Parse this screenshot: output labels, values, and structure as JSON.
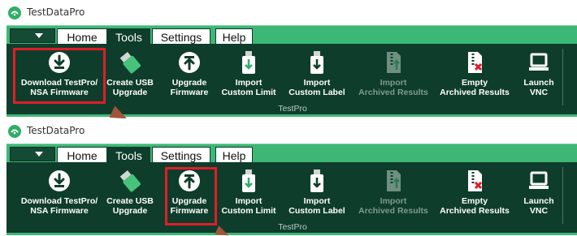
{
  "panels": [
    {
      "app": {
        "title": "TestDataPro",
        "logo": "testdatapro-logo-icon"
      },
      "tabs": [
        {
          "label": "Home",
          "active": false
        },
        {
          "label": "Tools",
          "active": true
        },
        {
          "label": "Settings",
          "active": false
        },
        {
          "label": "Help",
          "active": false
        }
      ],
      "tools": [
        {
          "label": "Download TestPro/\nNSA Firmware",
          "icon": "download-circle-icon",
          "enabled": true
        },
        {
          "label": "Create USB\nUpgrade",
          "icon": "usb-drive-icon",
          "enabled": true
        },
        {
          "label": "Upgrade\nFirmware",
          "icon": "upgrade-circle-icon",
          "enabled": true
        },
        {
          "label": "Import\nCustom Limit",
          "icon": "usb-import-limit-icon",
          "enabled": true
        },
        {
          "label": "Import\nCustom Label",
          "icon": "usb-import-label-icon",
          "enabled": true
        },
        {
          "label": "Import\nArchived Results",
          "icon": "archive-import-icon",
          "enabled": false
        },
        {
          "label": "Empty\nArchived Results",
          "icon": "archive-empty-icon",
          "enabled": true
        },
        {
          "label": "Launch\nVNC",
          "icon": "laptop-icon",
          "enabled": true
        }
      ],
      "group_label": "TestPro",
      "highlighted_tool": "Download TestPro/ NSA Firmware"
    },
    {
      "app": {
        "title": "TestDataPro",
        "logo": "testdatapro-logo-icon"
      },
      "tabs": [
        {
          "label": "Home",
          "active": false
        },
        {
          "label": "Tools",
          "active": true
        },
        {
          "label": "Settings",
          "active": false
        },
        {
          "label": "Help",
          "active": false
        }
      ],
      "tools": [
        {
          "label": "Download TestPro/\nNSA Firmware",
          "icon": "download-circle-icon",
          "enabled": true
        },
        {
          "label": "Create USB\nUpgrade",
          "icon": "usb-drive-icon",
          "enabled": true
        },
        {
          "label": "Upgrade\nFirmware",
          "icon": "upgrade-circle-icon",
          "enabled": true
        },
        {
          "label": "Import\nCustom Limit",
          "icon": "usb-import-limit-icon",
          "enabled": true
        },
        {
          "label": "Import\nCustom Label",
          "icon": "usb-import-label-icon",
          "enabled": true
        },
        {
          "label": "Import\nArchived Results",
          "icon": "archive-import-icon",
          "enabled": false
        },
        {
          "label": "Empty\nArchived Results",
          "icon": "archive-empty-icon",
          "enabled": true
        },
        {
          "label": "Launch\nVNC",
          "icon": "laptop-icon",
          "enabled": true
        }
      ],
      "group_label": "TestPro",
      "highlighted_tool": "Upgrade Firmware"
    }
  ],
  "colors": {
    "ribbon": "#0f3d2c",
    "tabbar": "#3db776",
    "highlight": "#e11d2a",
    "arrow": "#a0543a",
    "disabled_text": "#7e9a8d"
  }
}
